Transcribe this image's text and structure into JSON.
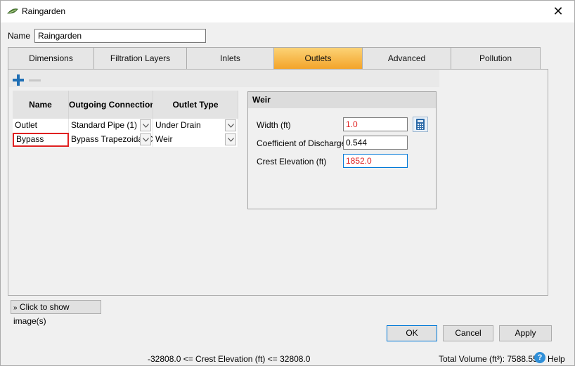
{
  "window": {
    "title": "Raingarden",
    "close_glyph": "✕",
    "icon": "raingarden-leaf-icon"
  },
  "name_field": {
    "label": "Name",
    "value": "Raingarden"
  },
  "tabs": [
    {
      "label": "Dimensions",
      "active": false
    },
    {
      "label": "Filtration Layers",
      "active": false
    },
    {
      "label": "Inlets",
      "active": false
    },
    {
      "label": "Outlets",
      "active": true
    },
    {
      "label": "Advanced",
      "active": false
    },
    {
      "label": "Pollution",
      "active": false
    }
  ],
  "toolbar": {
    "add_icon": "plus-icon",
    "remove_icon": "minus-icon"
  },
  "grid": {
    "columns": [
      "Name",
      "Outgoing Connection",
      "Outlet Type"
    ],
    "rows": [
      {
        "name": "Outlet",
        "connection": "Standard Pipe (1)",
        "type": "Under Drain"
      },
      {
        "name": "Bypass",
        "connection": "Bypass Trapezoidal C",
        "type": "Weir"
      }
    ]
  },
  "weir": {
    "title": "Weir",
    "width_label": "Width (ft)",
    "width_value": "1.0",
    "cod_label": "Coefficient of Discharge",
    "cod_value": "0.544",
    "crest_label": "Crest Elevation (ft)",
    "crest_value": "1852.0"
  },
  "show_images": {
    "label": "Click to show image(s)"
  },
  "buttons": {
    "ok": "OK",
    "cancel": "Cancel",
    "apply": "Apply"
  },
  "status": {
    "range": "-32808.0 <= Crest Elevation (ft) <= 32808.0",
    "total_volume": "Total Volume (ft³): 7588.550",
    "help": "Help"
  },
  "colors": {
    "active_tab": "#f3a42a",
    "error_text": "#e02020",
    "add_icon": "#1f6fb5"
  }
}
